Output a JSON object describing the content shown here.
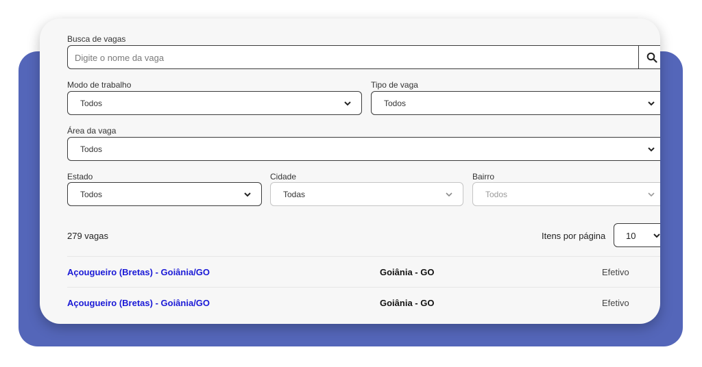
{
  "search": {
    "label": "Busca de vagas",
    "placeholder": "Digite o nome da vaga"
  },
  "filters": {
    "work_mode": {
      "label": "Modo de trabalho",
      "value": "Todos"
    },
    "job_type": {
      "label": "Tipo de vaga",
      "value": "Todos"
    },
    "area": {
      "label": "Área da vaga",
      "value": "Todos"
    },
    "state": {
      "label": "Estado",
      "value": "Todos"
    },
    "city": {
      "label": "Cidade",
      "value": "Todas"
    },
    "district": {
      "label": "Bairro",
      "value": "Todos"
    }
  },
  "results": {
    "count": "279 vagas",
    "per_page_label": "Itens por página",
    "per_page_value": "10",
    "rows": [
      {
        "title": "Açougueiro (Bretas) - Goiânia/GO",
        "city": "Goiânia - GO",
        "type": "Efetivo"
      },
      {
        "title": "Açougueiro (Bretas) - Goiânia/GO",
        "city": "Goiânia - GO",
        "type": "Efetivo"
      }
    ]
  },
  "colors": {
    "accent_backdrop": "#5466b9",
    "link": "#1a19d6"
  },
  "icons": {
    "search": "search-icon",
    "dropdown": "chevron-down-icon"
  }
}
